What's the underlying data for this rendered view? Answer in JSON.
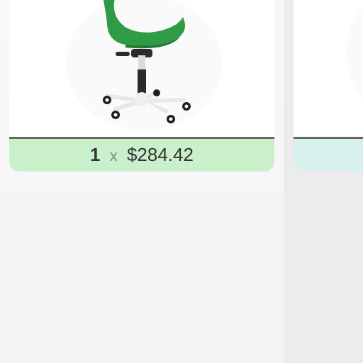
{
  "cards": [
    {
      "product": {
        "image_icon": "green-office-chair-icon",
        "image_colors": {
          "seat": "#2f9b45",
          "seat_shadow": "#1f7a34",
          "base": "#eaeaea",
          "post": "#2b2b2b",
          "wheel": "#1e1e1e"
        }
      },
      "quantity": "1",
      "times_symbol": "x",
      "price": "$284.42",
      "price_bar_color": "#c9f0ca"
    },
    {
      "product": {
        "image_icon": "product-image-partial-icon"
      },
      "price_bar_color": "#d8f1ee"
    }
  ]
}
